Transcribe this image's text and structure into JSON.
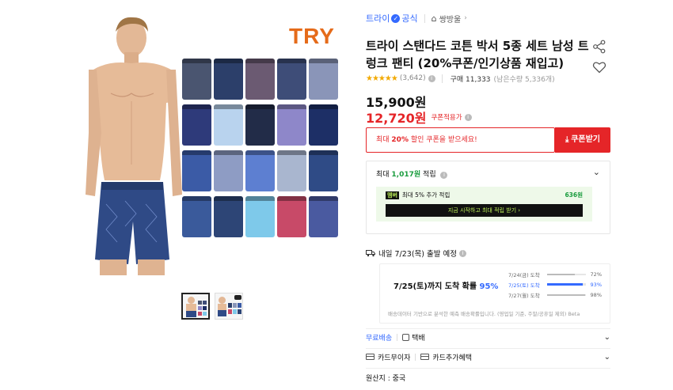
{
  "gallery": {
    "brand_logo": "TRY",
    "swatch_colors": [
      "#4a5570",
      "#2c3f6a",
      "#6b5a72",
      "#3e4d78",
      "#8a95b8",
      "#2e3a7a",
      "#b9d3ee",
      "#222c48",
      "#8e87c9",
      "#1d2f66",
      "#3b5ba6",
      "#8e9cc4",
      "#5d7fd1",
      "#a9b6cf",
      "#2f4b86",
      "#3a5a9b",
      "#2d4576",
      "#7ec9ea",
      "#c84a68",
      "#4a5aa0"
    ],
    "thumbnails": [
      {
        "name": "thumbnail-1",
        "active": true
      },
      {
        "name": "thumbnail-2",
        "active": false
      }
    ]
  },
  "product": {
    "brand": "트라이",
    "official_badge": "공식",
    "store_name": "쌍방울",
    "title": "트라이 스탠다드 코튼 박서 5종 세트 남성 트렁크 팬티 (20%쿠폰/인기상품 재입고)",
    "rating_stars": "★★★★★",
    "review_count": "(3,642)",
    "purchase_count": "구매 11,333",
    "stock_left": "(남은수량 5,336개)",
    "price": "15,900원",
    "sale_price": "12,720원",
    "coupon_applied": "쿠폰적용가"
  },
  "coupon": {
    "pre": "최대 ",
    "pct": "20%",
    "post": " 할인 쿠폰을 받으세요!",
    "button": "쿠폰받기"
  },
  "reward": {
    "pre": "최대 ",
    "amount": "1,017원",
    "post": " 적립",
    "member_badge": "멤버",
    "member_text": "최대 5% 추가 적립",
    "member_amount": "636원",
    "member_cta": "지금 시작하고 최대 적립 받기 ›"
  },
  "shipping": {
    "departure": "내일 7/23(목) 출발 예정",
    "eta_pre": "7/25(토)까지 도착 확률 ",
    "eta_pct": "95%",
    "eta_items": [
      {
        "label": "7/24(금) 도착",
        "pct": "72%",
        "value": 0.72,
        "highlight": false
      },
      {
        "label": "7/25(토) 도착",
        "pct": "93%",
        "value": 0.93,
        "highlight": true
      },
      {
        "label": "7/27(월) 도착",
        "pct": "98%",
        "value": 0.98,
        "highlight": false
      }
    ],
    "eta_note": "배송데이터 기반으로 분석한 예측 배송확률입니다. (영업일 기준, 주말/공휴일 제외) Beta"
  },
  "options": {
    "free_ship": "무료배송",
    "parcel": "택배",
    "card_interest": "카드무이자",
    "card_benefit": "카드추가혜택",
    "origin": "원산지 : 중국"
  },
  "colors": {
    "accent_blue": "#346aff",
    "sale_red": "#e52528",
    "reward_green": "#1a9c3e",
    "brand_orange": "#e56b1a"
  }
}
